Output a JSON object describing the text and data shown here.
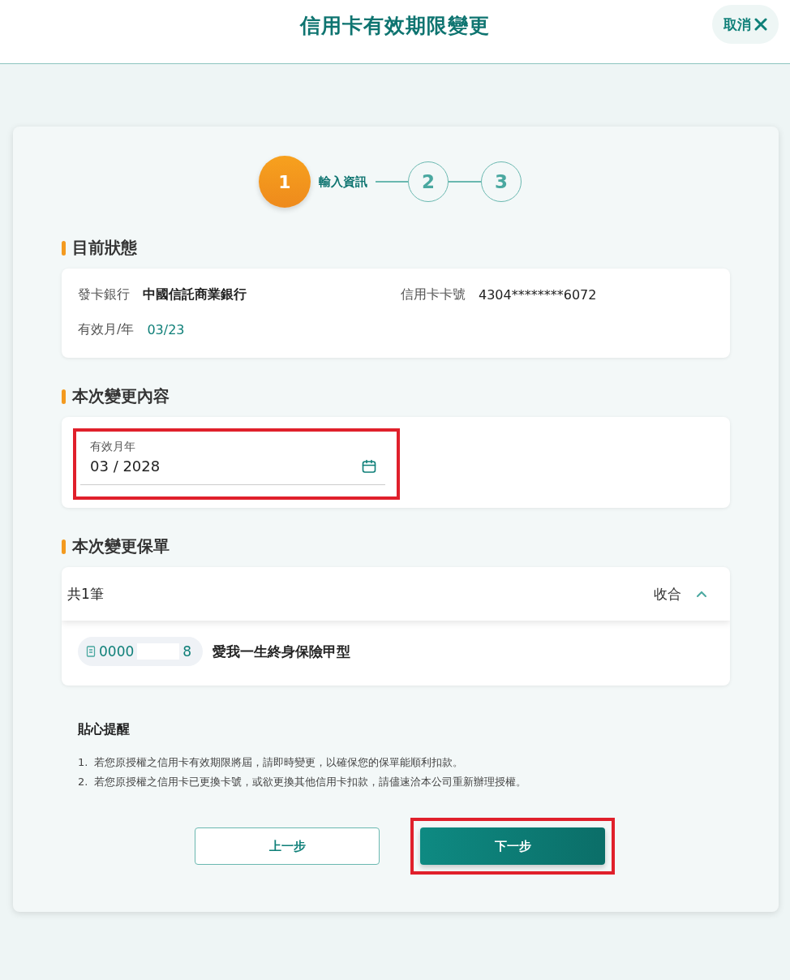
{
  "header": {
    "title": "信用卡有效期限變更",
    "cancel_button": "取消"
  },
  "stepper": [
    {
      "number": "1",
      "label": "輸入資訊",
      "selected": true
    },
    {
      "number": "2",
      "selected": false
    },
    {
      "number": "3",
      "selected": false
    }
  ],
  "current_status": {
    "title": "目前狀態",
    "fields": [
      {
        "label": "發卡銀行",
        "value": "中國信託商業銀行",
        "kind": "bold"
      },
      {
        "label": "信用卡卡號",
        "value": "4304********6072",
        "kind": "plain"
      },
      {
        "label": "有效月/年",
        "value": "03/23",
        "kind": "accent"
      }
    ]
  },
  "change": {
    "title": "本次變更內容",
    "date_field": {
      "label": "有效月年",
      "value": "03 / 2028",
      "highlighted": true
    }
  },
  "policies": {
    "title": "本次變更保單",
    "count": "共1筆",
    "toggle": "收合",
    "expanded": true,
    "items": [
      {
        "number_start": "0000",
        "number_end": "8",
        "name": "愛我一生終身保險甲型"
      }
    ]
  },
  "reminder": {
    "title": "貼心提醒",
    "items": [
      {
        "number": "1.",
        "text": "若您原授權之信用卡有效期限將屆，請即時變更，以確保您的保單能順利扣款。"
      },
      {
        "number": "2.",
        "text": "若您原授權之信用卡已更換卡號，或欲更換其他信用卡扣款，請儘速洽本公司重新辦理授權。"
      }
    ]
  },
  "buttons": [
    {
      "label": "上一步",
      "kind": "secondary",
      "highlighted": false
    },
    {
      "label": "下一步",
      "kind": "primary",
      "highlighted": true
    }
  ]
}
